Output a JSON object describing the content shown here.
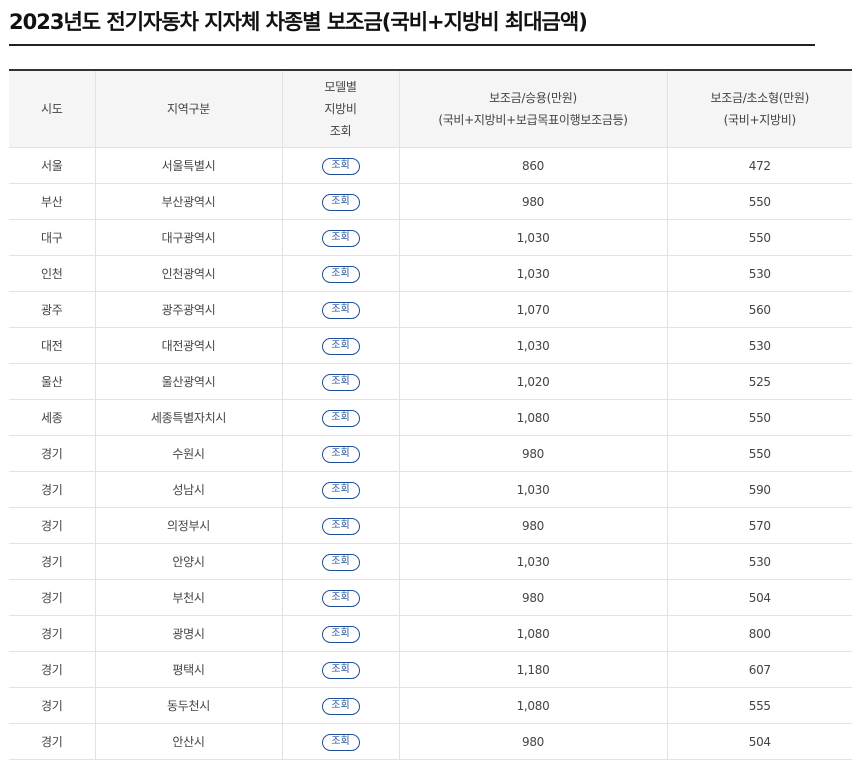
{
  "page": {
    "title": "2023년도 전기자동차 지자체 차종별 보조금(국비+지방비 최대금액)"
  },
  "table": {
    "headers": {
      "region": "시도",
      "district": "지역구분",
      "model_line1": "모델별",
      "model_line2": "지방비",
      "model_line3": "조회",
      "passenger_line1": "보조금/승용(만원)",
      "passenger_line2": "(국비+지방비+보급목표이행보조금등)",
      "small_line1": "보조금/초소형(만원)",
      "small_line2": "(국비+지방비)"
    },
    "button_label": "조회",
    "rows": [
      {
        "region": "서울",
        "district": "서울특별시",
        "passenger": "860",
        "small": "472"
      },
      {
        "region": "부산",
        "district": "부산광역시",
        "passenger": "980",
        "small": "550"
      },
      {
        "region": "대구",
        "district": "대구광역시",
        "passenger": "1,030",
        "small": "550"
      },
      {
        "region": "인천",
        "district": "인천광역시",
        "passenger": "1,030",
        "small": "530"
      },
      {
        "region": "광주",
        "district": "광주광역시",
        "passenger": "1,070",
        "small": "560"
      },
      {
        "region": "대전",
        "district": "대전광역시",
        "passenger": "1,030",
        "small": "530"
      },
      {
        "region": "울산",
        "district": "울산광역시",
        "passenger": "1,020",
        "small": "525"
      },
      {
        "region": "세종",
        "district": "세종특별자치시",
        "passenger": "1,080",
        "small": "550"
      },
      {
        "region": "경기",
        "district": "수원시",
        "passenger": "980",
        "small": "550"
      },
      {
        "region": "경기",
        "district": "성남시",
        "passenger": "1,030",
        "small": "590"
      },
      {
        "region": "경기",
        "district": "의정부시",
        "passenger": "980",
        "small": "570"
      },
      {
        "region": "경기",
        "district": "안양시",
        "passenger": "1,030",
        "small": "530"
      },
      {
        "region": "경기",
        "district": "부천시",
        "passenger": "980",
        "small": "504"
      },
      {
        "region": "경기",
        "district": "광명시",
        "passenger": "1,080",
        "small": "800"
      },
      {
        "region": "경기",
        "district": "평택시",
        "passenger": "1,180",
        "small": "607"
      },
      {
        "region": "경기",
        "district": "동두천시",
        "passenger": "1,080",
        "small": "555"
      },
      {
        "region": "경기",
        "district": "안산시",
        "passenger": "980",
        "small": "504"
      }
    ]
  },
  "colors": {
    "button_accent": "#1f4e9c",
    "header_bg": "#f5f5f5"
  }
}
